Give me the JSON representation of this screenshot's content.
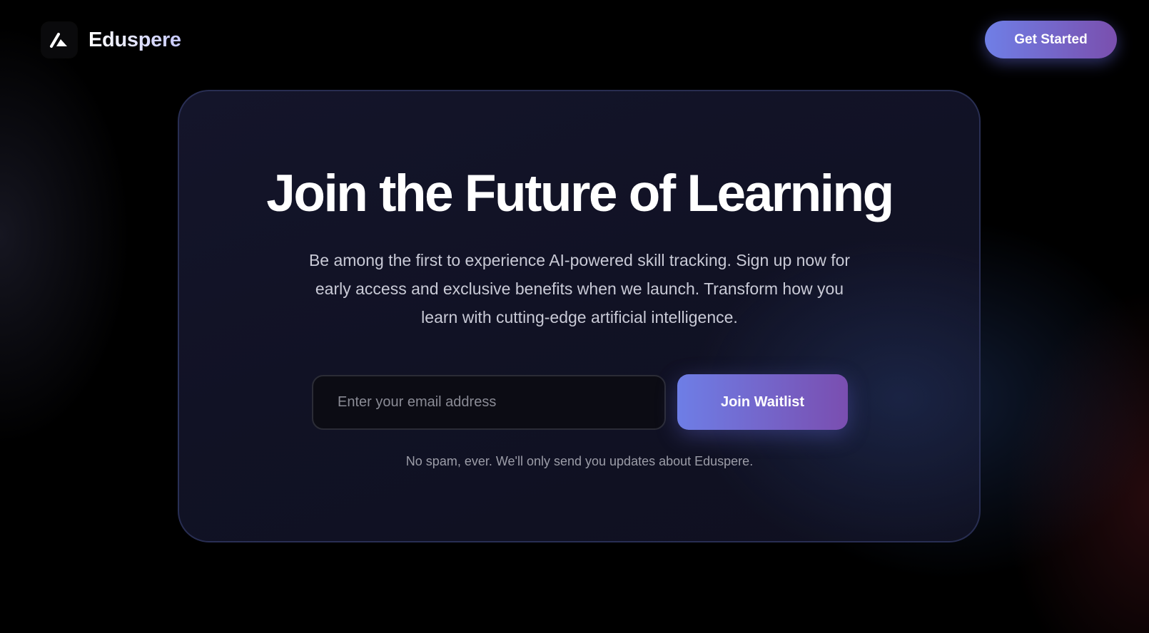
{
  "brand": {
    "name": "Eduspere",
    "logo_icon": "eduspere-logo-icon"
  },
  "header": {
    "cta_label": "Get Started"
  },
  "hero": {
    "title": "Join the Future of Learning",
    "subtitle": "Be among the first to experience AI-powered skill tracking. Sign up now for early access and exclusive benefits when we launch. Transform how you learn with cutting-edge artificial intelligence."
  },
  "waitlist": {
    "email_placeholder": "Enter your email address",
    "email_value": "",
    "submit_label": "Join Waitlist",
    "disclaimer": "No spam, ever. We'll only send you updates about Eduspere."
  },
  "colors": {
    "background": "#000000",
    "card": "#121326",
    "accent_start": "#6f7fe6",
    "accent_end": "#7a4fae"
  }
}
